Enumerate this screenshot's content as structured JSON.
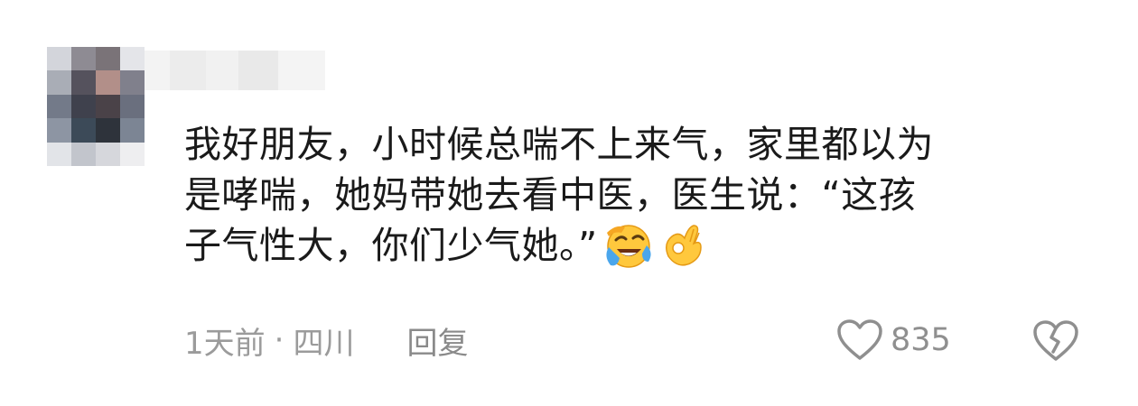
{
  "comment": {
    "lines": [
      "我好朋友，小时候总喘不上来气，家里都以为",
      "是哮喘，她妈带她去看中医，医生说：“这孩",
      "子气性大，你们少气她。”"
    ],
    "emojis": [
      "laughing-crying-emoji",
      "ok-hand-emoji"
    ]
  },
  "meta": {
    "time": "1天前",
    "separator": "·",
    "location": "四川",
    "reply_label": "回复"
  },
  "actions": {
    "like_count": "835",
    "like_icon": "heart-outline-icon",
    "dislike_icon": "broken-heart-icon"
  },
  "colors": {
    "text": "#1a1a1a",
    "meta": "#9b9b9b",
    "icon": "#8f8f8f"
  }
}
